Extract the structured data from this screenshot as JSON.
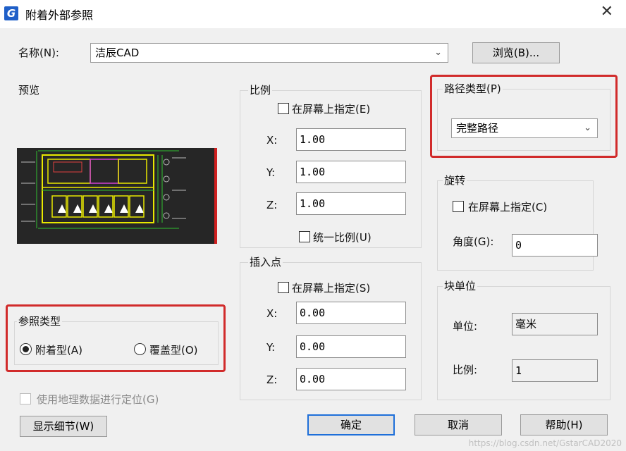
{
  "window": {
    "title": "附着外部参照",
    "app_icon": "G"
  },
  "name_row": {
    "label": "名称(N):",
    "value": "洁辰CAD",
    "browse_label": "浏览(B)..."
  },
  "preview": {
    "label": "预览"
  },
  "scale": {
    "title": "比例",
    "specify_on_screen": "在屏幕上指定(E)",
    "x_label": "X:",
    "x_value": "1.00",
    "y_label": "Y:",
    "y_value": "1.00",
    "z_label": "Z:",
    "z_value": "1.00",
    "uniform_label": "统一比例(U)"
  },
  "insert_point": {
    "title": "插入点",
    "specify_on_screen": "在屏幕上指定(S)",
    "x_label": "X:",
    "x_value": "0.00",
    "y_label": "Y:",
    "y_value": "0.00",
    "z_label": "Z:",
    "z_value": "0.00"
  },
  "path_type": {
    "title": "路径类型(P)",
    "value": "完整路径"
  },
  "rotation": {
    "title": "旋转",
    "specify_on_screen": "在屏幕上指定(C)",
    "angle_label": "角度(G):",
    "angle_value": "0"
  },
  "block_unit": {
    "title": "块单位",
    "unit_label": "单位:",
    "unit_value": "毫米",
    "scale_label": "比例:",
    "scale_value": "1"
  },
  "reference_type": {
    "title": "参照类型",
    "attach_label": "附着型(A)",
    "overlay_label": "覆盖型(O)",
    "selected": "attach"
  },
  "geo_checkbox": {
    "label": "使用地理数据进行定位(G)"
  },
  "buttons": {
    "details": "显示细节(W)",
    "ok": "确定",
    "cancel": "取消",
    "help": "帮助(H)"
  },
  "watermark": "https://blog.csdn.net/GstarCAD2020",
  "colors": {
    "highlight": "#d12b2b",
    "default_button_border": "#1e6fd9",
    "app_icon": "#1f5fc8"
  }
}
